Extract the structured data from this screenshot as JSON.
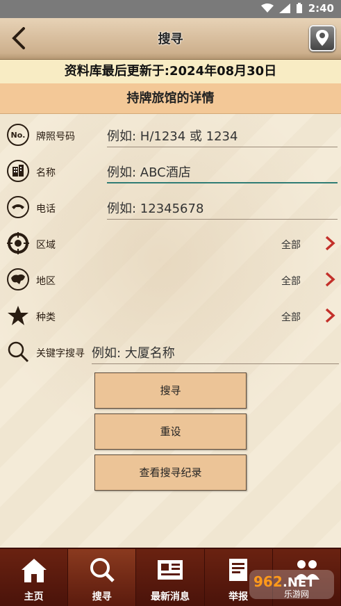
{
  "status": {
    "time": "2:40"
  },
  "header": {
    "title": "搜寻"
  },
  "update_text": "资料库最后更新于:2024年08月30日",
  "section_title": "持牌旅馆的详情",
  "fields": {
    "license": {
      "label": "牌照号码",
      "placeholder": "例如:  H/1234 或 1234"
    },
    "name": {
      "label": "名称",
      "placeholder": "例如: ABC酒店"
    },
    "phone": {
      "label": "电话",
      "placeholder": "例如: 12345678"
    },
    "district": {
      "label": "区域",
      "value": "全部"
    },
    "area": {
      "label": "地区",
      "value": "全部"
    },
    "category": {
      "label": "种类",
      "value": "全部"
    },
    "keyword": {
      "label": "关键字搜寻",
      "placeholder": "例如: 大厦名称"
    }
  },
  "buttons": {
    "search": "搜寻",
    "reset": "重设",
    "history": "查看搜寻纪录"
  },
  "tabs": [
    {
      "label": "主页"
    },
    {
      "label": "搜寻"
    },
    {
      "label": "最新消息"
    },
    {
      "label": "举报"
    },
    {
      "label": ""
    }
  ],
  "watermark": {
    "text1": "962.NET",
    "text2": "乐游网"
  },
  "colors": {
    "accent": "#2f7c74",
    "section": "#f3c897",
    "tabbar": "#5a1a0d",
    "button": "#ecc497"
  }
}
